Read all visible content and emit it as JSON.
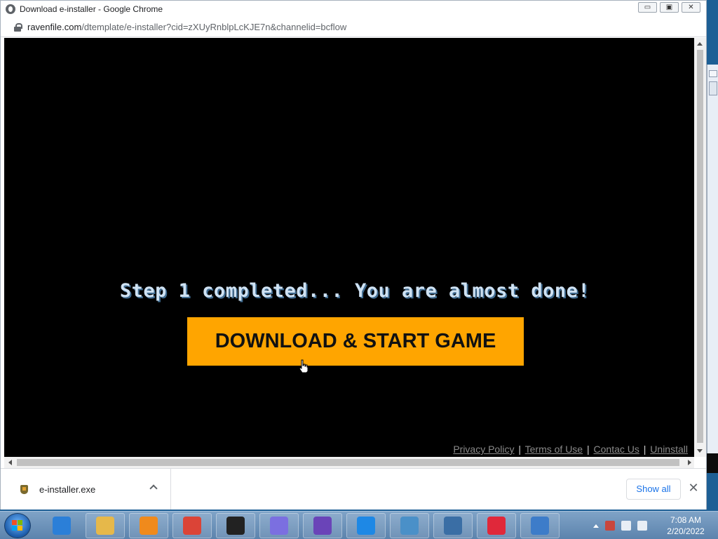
{
  "window": {
    "title": "Download e-installer - Google Chrome",
    "controls": {
      "minimize": "▭",
      "maximize": "▣",
      "close": "✕"
    }
  },
  "address": {
    "domain": "ravenfile.com",
    "path": "/dtemplate/e-installer?cid=zXUyRnblpLcKJE7n&channelid=bcflow"
  },
  "page": {
    "headline": "Step 1 completed... You are almost done!",
    "cta_label": "DOWNLOAD & START GAME",
    "cta_color": "#ffa500",
    "footer": {
      "privacy": "Privacy Policy",
      "terms": "Terms of Use",
      "contact": "Contac Us",
      "uninstall": "Uninstall",
      "separator": "|"
    }
  },
  "download_shelf": {
    "file_name": "e-installer.exe",
    "show_all": "Show all",
    "close": "✕"
  },
  "taskbar": {
    "apps": [
      {
        "name": "internet-explorer-icon",
        "color": "#2b7fd8"
      },
      {
        "name": "file-explorer-icon",
        "color": "#e6b84a"
      },
      {
        "name": "media-player-icon",
        "color": "#f08a1c"
      },
      {
        "name": "chrome-icon",
        "color": "#db4437"
      },
      {
        "name": "7zip-icon",
        "color": "#222222"
      },
      {
        "name": "triangle-app-icon",
        "color": "#7b6fe0"
      },
      {
        "name": "monster-app-icon",
        "color": "#6a44b8"
      },
      {
        "name": "shield-app-icon",
        "color": "#1e88e5"
      },
      {
        "name": "control-panel-icon",
        "color": "#4a90c8"
      },
      {
        "name": "keyboard-app-icon",
        "color": "#3a6ea5"
      },
      {
        "name": "opera-icon",
        "color": "#e0283a"
      },
      {
        "name": "network-app-icon",
        "color": "#3d7cc9"
      }
    ],
    "clock_time": "7:08 AM",
    "clock_date": "2/20/2022"
  }
}
